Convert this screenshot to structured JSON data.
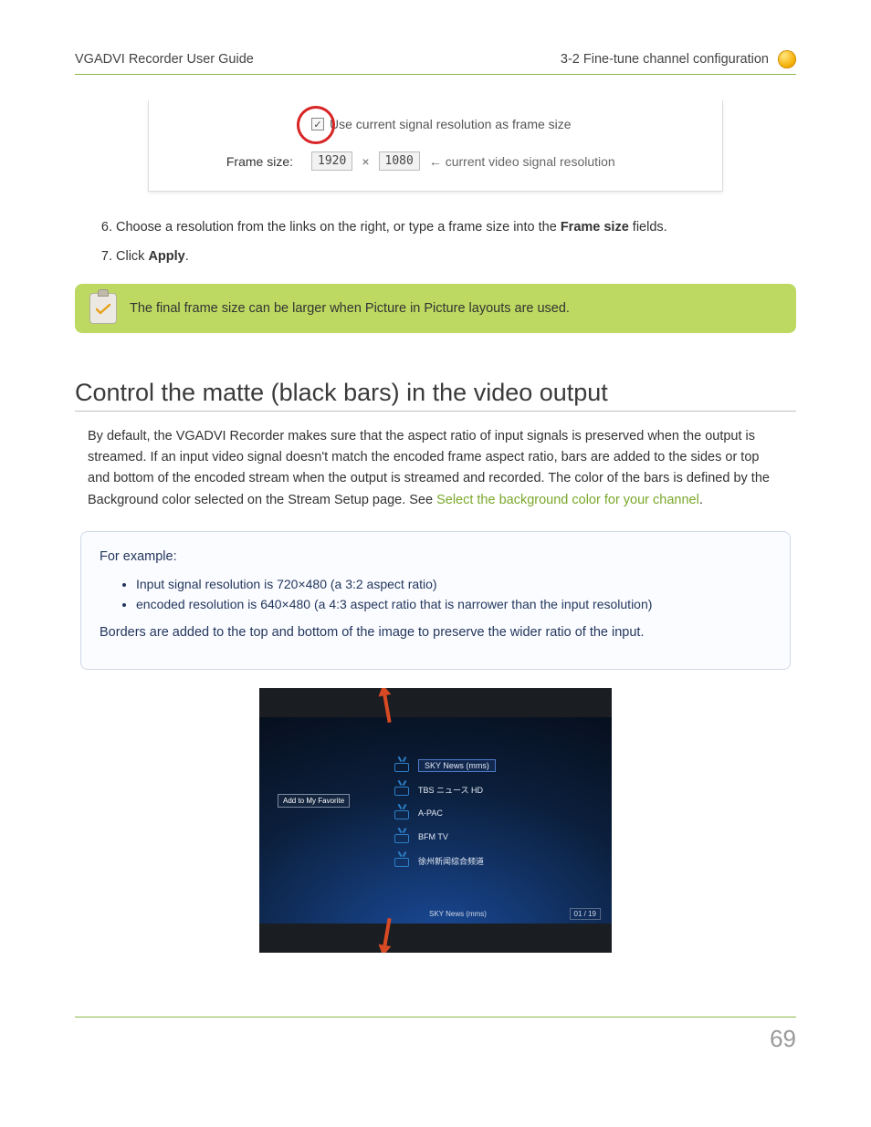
{
  "header": {
    "left": "VGADVI Recorder User Guide",
    "right": "3-2 Fine-tune channel configuration"
  },
  "frame_fig": {
    "checkbox_label": "Use current signal resolution as frame size",
    "label": "Frame size:",
    "width": "1920",
    "height": "1080",
    "hint": "← current video signal resolution"
  },
  "steps": {
    "step6_prefix": "Choose a resolution from the links on the right, or type a frame size into the ",
    "step6_bold": "Frame size",
    "step6_suffix": " fields.",
    "step7_prefix": "Click ",
    "step7_bold": "Apply",
    "step7_suffix": "."
  },
  "tip": {
    "text": "The final frame size can be larger when Picture in Picture layouts are used."
  },
  "section": {
    "title": "Control the matte (black bars) in the video output",
    "para_a": "By default, the VGADVI Recorder makes sure that the aspect ratio of input signals is preserved when the output is streamed. If an input video signal doesn't match the encoded frame aspect ratio, bars are added to the sides or top and bottom of the encoded stream when the output is streamed and recorded. The color of the bars is defined by the Background color selected on the Stream Setup page. See ",
    "link": "Select the background color for your channel",
    "para_b": "."
  },
  "example": {
    "lead": "For example:",
    "bullet1": "Input signal resolution is 720×480 (a 3:2 aspect ratio)",
    "bullet2": "encoded resolution is 640×480 (a 4:3 aspect ratio that is narrower than the input resolution)",
    "tail": "Borders are added to the top and bottom of the image to preserve the wider ratio of the input."
  },
  "tv": {
    "fav_button": "Add to My Favorite",
    "channels": [
      "SKY News (mms)",
      "TBS ニュース HD",
      "A-PAC",
      "BFM TV",
      "徐州新闻综合频道"
    ],
    "status": "SKY News (mms)",
    "page": "01 / 19"
  },
  "page_number": "69"
}
